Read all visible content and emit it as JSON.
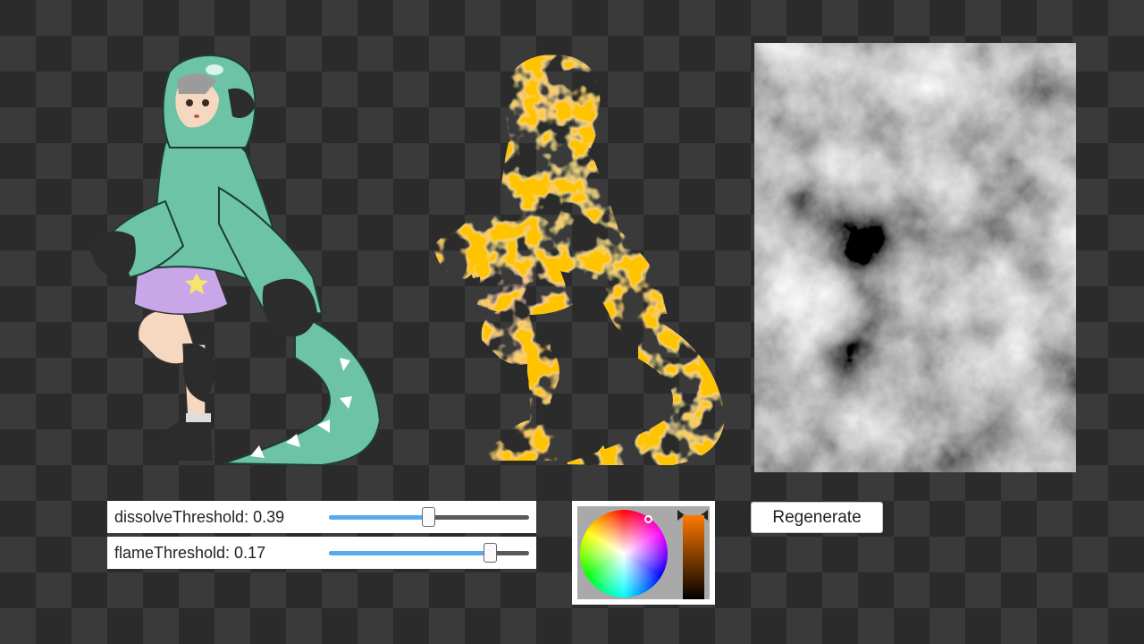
{
  "colors": {
    "hoodie": "#6cc3a5",
    "hoodie_dark": "#4a9a7f",
    "shorts": "#c9a6e8",
    "skin": "#f6d7bf",
    "hair": "#9b9b9b",
    "boots": "#2c2c2c",
    "flame": "#ff8a00",
    "glow": "#fff6a0",
    "slider_fill": "#5aaaf0",
    "picked_color": "#ff7a00"
  },
  "controls": {
    "dissolve": {
      "label": "dissolveThreshold: 0.39",
      "value": 0.39,
      "slider_fraction": 0.5
    },
    "flame": {
      "label": "flameThreshold: 0.17",
      "value": 0.17,
      "slider_fraction": 0.81
    }
  },
  "color_picker": {
    "wheel_icon": "hue-wheel",
    "value_icon": "value-bar"
  },
  "regenerate_button": {
    "label": "Regenerate"
  },
  "icons": {
    "original": "character-original-icon",
    "dissolved": "character-dissolved-icon",
    "noise": "noise-texture-icon"
  }
}
